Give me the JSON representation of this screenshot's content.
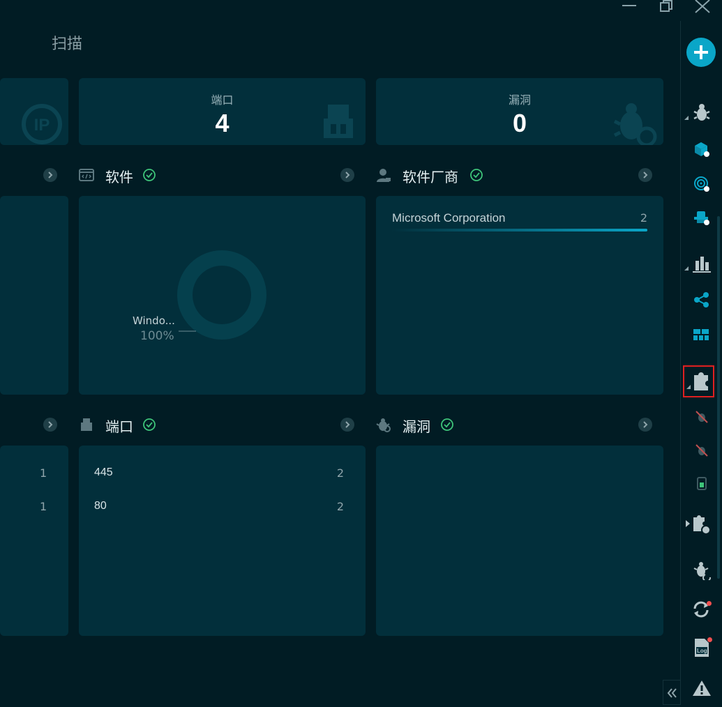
{
  "page": {
    "title": "扫描"
  },
  "stats": {
    "ports": {
      "label": "端口",
      "value": "4"
    },
    "vulns": {
      "label": "漏洞",
      "value": "0"
    }
  },
  "sections": {
    "software": {
      "title": "软件"
    },
    "vendors": {
      "title": "软件厂商"
    },
    "ports": {
      "title": "端口"
    },
    "vulns": {
      "title": "漏洞"
    }
  },
  "software_chart": {
    "chart_data": {
      "type": "pie",
      "categories": [
        "Windo..."
      ],
      "values": [
        100
      ],
      "labels": [
        "Windo..."
      ],
      "percent_labels": [
        "100%"
      ]
    }
  },
  "vendors_list": [
    {
      "name": "Microsoft Corporation",
      "count": "2",
      "fraction": 1.0
    }
  ],
  "left_panel_counts": [
    "1",
    "1"
  ],
  "ports_list": [
    {
      "port": "445",
      "count": "2"
    },
    {
      "port": "80",
      "count": "2"
    }
  ],
  "colors": {
    "accent": "#0aa6c8",
    "panel": "#022f3b",
    "background": "#011c24",
    "check": "#3ec47a",
    "highlight_border": "#e02020"
  },
  "rightbar_icons": [
    "add-icon",
    "bug-icon",
    "package-icon",
    "fingerprint-icon",
    "hat-icon",
    "bar-chart-icon",
    "share-icon",
    "grid-icon",
    "puzzle-icon",
    "bug-off-icon",
    "bug-off-icon",
    "battery-icon",
    "puzzle-gear-icon",
    "bug-sync-icon",
    "sync-icon",
    "log-icon",
    "warning-icon",
    "collapse-icon"
  ],
  "rightbar_labels": {
    "log": "Log"
  }
}
